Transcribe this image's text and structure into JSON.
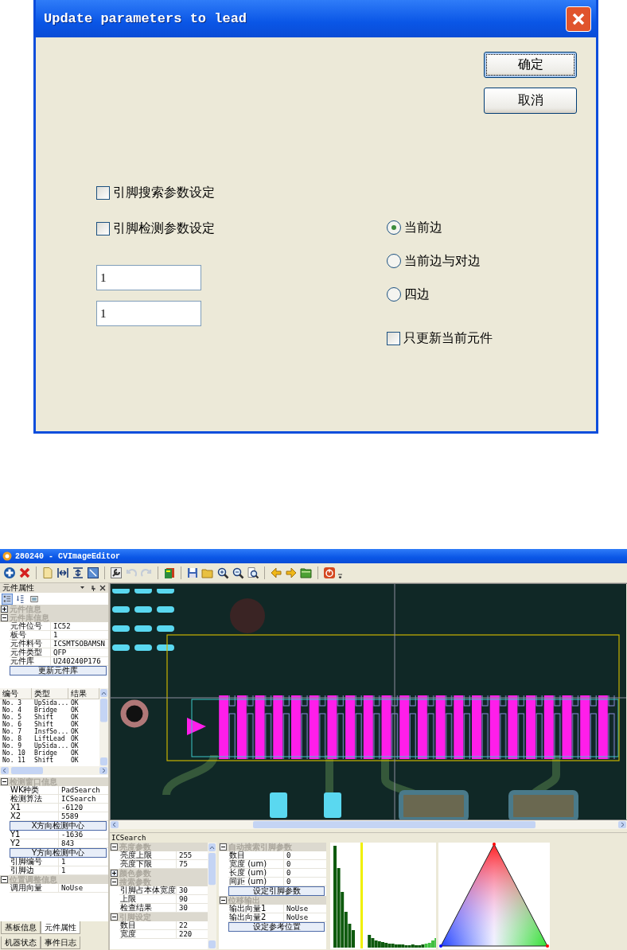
{
  "dialog": {
    "title": "Update parameters to lead",
    "buttons": [
      {
        "label": "确定",
        "focused": true
      },
      {
        "label": "取消",
        "focused": false
      }
    ],
    "checkboxes": [
      {
        "label": "引脚搜索参数设定",
        "checked": false
      },
      {
        "label": "引脚检测参数设定",
        "checked": false
      }
    ],
    "inputs": [
      {
        "value": "1"
      },
      {
        "value": "1"
      }
    ],
    "radios": [
      {
        "label": "当前边",
        "selected": true
      },
      {
        "label": "当前边与对边",
        "selected": false
      },
      {
        "label": "四边",
        "selected": false
      }
    ],
    "update_current_only": {
      "label": "只更新当前元件",
      "checked": false
    }
  },
  "editor": {
    "title": "280240 - CVImageEditor",
    "toolbar_groups": [
      {
        "items": [
          {
            "kind": "add",
            "disabled": false
          },
          {
            "kind": "delete",
            "disabled": false
          }
        ]
      },
      {
        "items": [
          {
            "kind": "open",
            "disabled": false
          },
          {
            "kind": "fit-width",
            "disabled": false
          },
          {
            "kind": "fit-height",
            "disabled": false
          },
          {
            "kind": "view",
            "disabled": false
          }
        ]
      },
      {
        "items": [
          {
            "kind": "settings",
            "disabled": false
          },
          {
            "kind": "undo",
            "disabled": true
          },
          {
            "kind": "redo",
            "disabled": true
          }
        ]
      },
      {
        "items": [
          {
            "kind": "book",
            "disabled": false
          }
        ]
      },
      {
        "items": [
          {
            "kind": "save",
            "disabled": false
          },
          {
            "kind": "folder",
            "disabled": false
          },
          {
            "kind": "zoom-in",
            "disabled": false
          },
          {
            "kind": "zoom-out",
            "disabled": false
          },
          {
            "kind": "zoom-page",
            "disabled": false
          }
        ]
      },
      {
        "items": [
          {
            "kind": "prev",
            "disabled": false
          },
          {
            "kind": "next",
            "disabled": false
          },
          {
            "kind": "green-folder",
            "disabled": false
          }
        ]
      },
      {
        "items": [
          {
            "kind": "power",
            "disabled": false
          }
        ]
      }
    ],
    "left_panel": {
      "title": "元件属性",
      "view_buttons": [
        {
          "kind": "categorized",
          "selected": true
        },
        {
          "kind": "alphabetical",
          "selected": false
        },
        {
          "kind": "pages",
          "selected": false
        }
      ],
      "component_sections": [
        {
          "title": "元件信息",
          "expanded": false
        },
        {
          "title": "元件库信息",
          "expanded": true,
          "items": [
            {
              "kind": "row",
              "name": "元件位号",
              "value": "IC52"
            },
            {
              "kind": "row",
              "name": "板号",
              "value": "1"
            },
            {
              "kind": "row",
              "name": "元件料号",
              "value": "ICSMTSOBAMSN"
            },
            {
              "kind": "row",
              "name": "元件类型",
              "value": "QFP"
            },
            {
              "kind": "row",
              "name": "元件库",
              "value": "U240240P176"
            },
            {
              "kind": "button",
              "label": "更新元件库"
            }
          ]
        }
      ],
      "results": {
        "columns": [
          "编号",
          "类型",
          "结果"
        ],
        "rows": [
          [
            "No. 3",
            "UpSida...",
            "OK"
          ],
          [
            "No. 4",
            "Bridge",
            "OK"
          ],
          [
            "No. 5",
            "Shift",
            "OK"
          ],
          [
            "No. 6",
            "Shift",
            "OK"
          ],
          [
            "No. 7",
            "InsfSo...",
            "OK"
          ],
          [
            "No. 8",
            "LiftLead",
            "OK"
          ],
          [
            "No. 9",
            "UpSida...",
            "OK"
          ],
          [
            "No. 10",
            "Bridge",
            "OK"
          ],
          [
            "No. 11",
            "Shift",
            "OK"
          ]
        ]
      },
      "window_sections": [
        {
          "title": "检测窗口信息",
          "expanded": true,
          "items": [
            {
              "kind": "row",
              "name": "WK种类",
              "value": "PadSearch"
            },
            {
              "kind": "row",
              "name": "检测算法",
              "value": "ICSearch"
            },
            {
              "kind": "row",
              "name": "X1",
              "value": "-6120"
            },
            {
              "kind": "row",
              "name": "X2",
              "value": "5589"
            },
            {
              "kind": "button",
              "label": "X方向检测中心"
            },
            {
              "kind": "row",
              "name": "Y1",
              "value": "-1636"
            },
            {
              "kind": "row",
              "name": "Y2",
              "value": "843"
            },
            {
              "kind": "button",
              "label": "Y方向检测中心"
            },
            {
              "kind": "row",
              "name": "引脚编号",
              "value": "1"
            },
            {
              "kind": "row",
              "name": "引脚边",
              "value": "1"
            }
          ]
        },
        {
          "title": "位置调整信息",
          "expanded": true,
          "items": [
            {
              "kind": "row",
              "name": "调用向量",
              "value": "NoUse"
            }
          ]
        }
      ],
      "tabs": [
        {
          "label": "基板信息",
          "selected": false
        },
        {
          "label": "元件属性",
          "selected": true
        }
      ],
      "tabs_lower": [
        {
          "label": "机器状态",
          "selected": false
        },
        {
          "label": "事件日志",
          "selected": false
        }
      ]
    },
    "bottom_panel": {
      "title": "ICSearch",
      "grid_left": [
        {
          "title": "亮度参数",
          "expanded": true,
          "items": [
            {
              "kind": "row",
              "name": "亮度上限",
              "value": "255"
            },
            {
              "kind": "row",
              "name": "亮度下限",
              "value": "75"
            }
          ]
        },
        {
          "title": "颜色参数",
          "expanded": false
        },
        {
          "title": "搜索参数",
          "expanded": true,
          "items": [
            {
              "kind": "row",
              "name": "引脚占本体宽度",
              "value": "30"
            },
            {
              "kind": "row",
              "name": "上限",
              "value": "90"
            },
            {
              "kind": "row",
              "name": "检查结果",
              "value": "30"
            }
          ]
        },
        {
          "title": "引脚设定",
          "expanded": true,
          "items": [
            {
              "kind": "row",
              "name": "数目",
              "value": "22"
            },
            {
              "kind": "row",
              "name": "宽度",
              "value": "220"
            }
          ]
        }
      ],
      "grid_right": [
        {
          "title": "自动搜索引脚参数",
          "expanded": true,
          "items": [
            {
              "kind": "row",
              "name": "数目",
              "value": "0"
            },
            {
              "kind": "row",
              "name": "宽度 (um)",
              "value": "0"
            },
            {
              "kind": "row",
              "name": "长度 (um)",
              "value": "0"
            },
            {
              "kind": "row",
              "name": "间距 (um)",
              "value": "0"
            },
            {
              "kind": "button",
              "label": "设定引脚参数"
            }
          ]
        },
        {
          "title": "位移输出",
          "expanded": true,
          "items": [
            {
              "kind": "row",
              "name": "输出向量1",
              "value": "NoUse"
            },
            {
              "kind": "row",
              "name": "输出向量2",
              "value": "NoUse"
            },
            {
              "kind": "button",
              "label": "设定参考位置"
            }
          ]
        }
      ]
    }
  }
}
